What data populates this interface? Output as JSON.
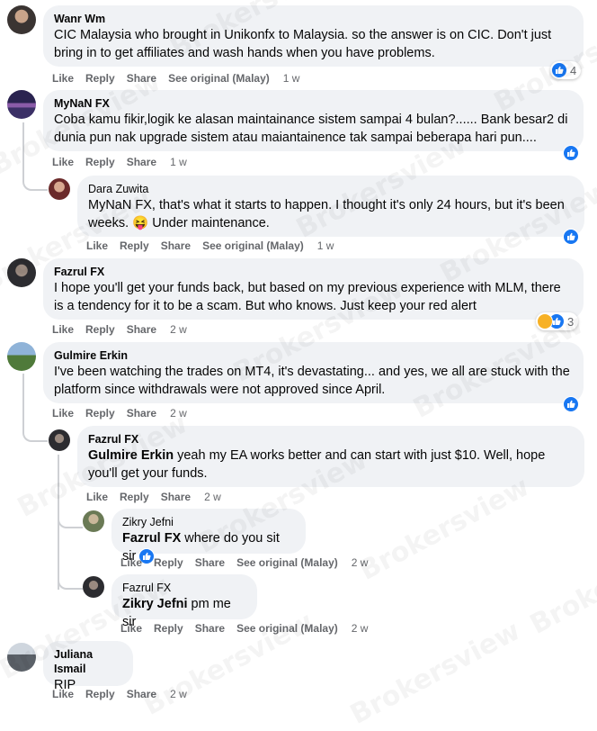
{
  "actions": {
    "like": "Like",
    "reply": "Reply",
    "share": "Share",
    "see_original": "See original (Malay)"
  },
  "comments": [
    {
      "name": "Wanr Wm",
      "text": "CIC Malaysia who brought in Unikonfx to Malaysia. so the answer is on CIC. Don't just bring in to get affiliates and wash hands when you have problems.",
      "time": "1 w",
      "reaction_count": "4"
    },
    {
      "name": "MyNaN FX",
      "text": "Coba kamu fikir,logik ke alasan maintainance sistem sampai 4 bulan?...... Bank besar2 di dunia pun nak upgrade sistem atau maiantainence tak sampai beberapa hari pun....",
      "time": "1 w"
    },
    {
      "name": "Dara Zuwita",
      "text": "MyNaN FX, that's what it starts to happen. I thought it's only 24 hours, but it's been weeks. 😝 Under maintenance.",
      "time": "1 w"
    },
    {
      "name": "Fazrul FX",
      "text": "I hope you'll get your funds back, but based on my previous experience with MLM, there is a tendency for it to be a scam. But who knows. Just keep your red alert",
      "time": "2 w",
      "reaction_count": "3"
    },
    {
      "name": "Gulmire Erkin",
      "text": "I've been watching the trades on MT4, it's devastating... and yes, we all are stuck with the platform since withdrawals were not approved since April.",
      "time": "2 w"
    },
    {
      "name": "Fazrul FX",
      "tag": "Gulmire Erkin",
      "text": " yeah my EA works better and can start with just $10. Well, hope you'll get your funds.",
      "time": "2 w"
    },
    {
      "name": "Zikry Jefni",
      "tag": "Fazrul FX",
      "text": " where do you sit sir",
      "time": "2 w"
    },
    {
      "name": "Fazrul FX",
      "tag": "Zikry Jefni",
      "text": " pm me sir",
      "time": "2 w"
    },
    {
      "name": "Juliana Ismail",
      "text": "RIP",
      "time": "2 w"
    }
  ],
  "watermark": "Brokersview"
}
